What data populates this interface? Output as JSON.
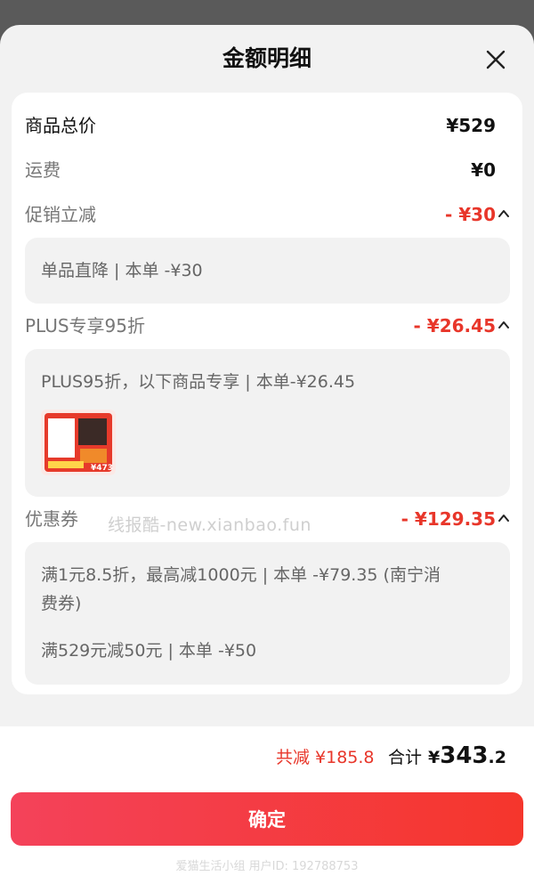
{
  "header": {
    "title": "金额明细"
  },
  "rows": {
    "total": {
      "label": "商品总价",
      "amount": "¥529"
    },
    "shipping": {
      "label": "运费",
      "amount": "¥0"
    },
    "promo": {
      "label": "促销立减",
      "amount": "- ¥30",
      "detail": "单品直降 | 本单 -¥30"
    },
    "plus": {
      "label": "PLUS专享95折",
      "amount": "- ¥26.45",
      "detail": "PLUS95折，以下商品专享 | 本单-¥26.45"
    },
    "coupon": {
      "label": "优惠券",
      "amount": "- ¥129.35",
      "details": [
        "满1元8.5折，最高减1000元 | 本单 -¥79.35 (南宁消",
        "费券)",
        "满529元减50元 | 本单 -¥50"
      ]
    }
  },
  "watermark": "线报酷-new.xianbao.fun",
  "product_thumb": {
    "badge_text": "¥473"
  },
  "totals": {
    "saved": "共减 ¥185.8",
    "sum_label": "合计",
    "sum_currency": "¥",
    "sum_int": "343",
    "sum_dec": ".2"
  },
  "confirm_label": "确定",
  "footer_text": "爱猫生活小组   用户ID: 192788753",
  "colors": {
    "accent": "#e8362a",
    "button_start": "#f4425a",
    "button_end": "#f5362c"
  },
  "icons": {
    "close": "close-icon",
    "chevron": "chevron-up-icon"
  }
}
